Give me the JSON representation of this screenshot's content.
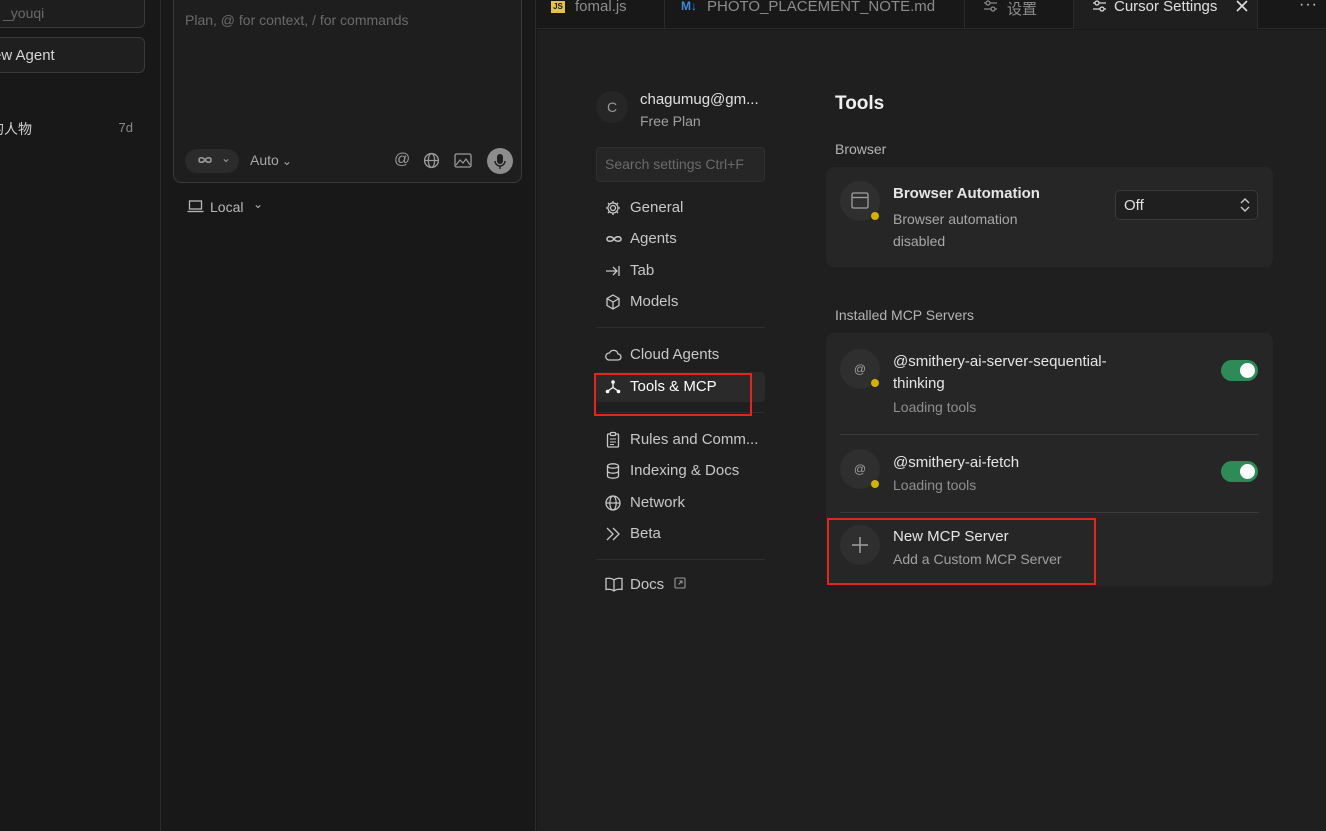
{
  "left_sidebar": {
    "search_text": "_youqi",
    "new_agent_label": "ew Agent",
    "history": [
      {
        "title": "的人物",
        "age": "7d"
      }
    ]
  },
  "composer": {
    "placeholder": "Plan, @ for context, / for commands",
    "mode_icon": "infinity-icon",
    "model_label": "Auto",
    "location_label": "Local"
  },
  "tabs": [
    {
      "label": "fomal.js",
      "icon": "js-file-icon"
    },
    {
      "label": "PHOTO_PLACEMENT_NOTE.md",
      "icon": "markdown-icon"
    },
    {
      "label": "设置",
      "icon": "settings-sliders-icon"
    },
    {
      "label": "Cursor Settings",
      "icon": "settings-sliders-icon",
      "active": true
    }
  ],
  "settings": {
    "user": {
      "initial": "C",
      "email": "chagumug@gm...",
      "plan": "Free Plan"
    },
    "search_placeholder": "Search settings Ctrl+F",
    "nav": [
      {
        "label": "General",
        "icon": "gear-icon"
      },
      {
        "label": "Agents",
        "icon": "infinity-icon"
      },
      {
        "label": "Tab",
        "icon": "tab-arrow-icon"
      },
      {
        "label": "Models",
        "icon": "cube-icon"
      },
      {
        "label": "Cloud Agents",
        "icon": "cloud-icon"
      },
      {
        "label": "Tools & MCP",
        "icon": "network-nodes-icon",
        "selected": true
      },
      {
        "label": "Rules and Comm...",
        "icon": "clipboard-icon"
      },
      {
        "label": "Indexing & Docs",
        "icon": "database-icon"
      },
      {
        "label": "Network",
        "icon": "globe-icon"
      },
      {
        "label": "Beta",
        "icon": "double-chevron-icon"
      },
      {
        "label": "Docs",
        "icon": "book-icon"
      }
    ],
    "title": "Tools",
    "browser_section": "Browser",
    "browser_automation": {
      "title": "Browser Automation",
      "subtitle_line1": "Browser automation",
      "subtitle_line2": "disabled",
      "value": "Off"
    },
    "mcp_section": "Installed MCP Servers",
    "mcp_servers": [
      {
        "name_line1": "@smithery-ai-server-sequential-",
        "name_line2": "thinking",
        "status": "Loading tools",
        "enabled": true
      },
      {
        "name_line1": "@smithery-ai-fetch",
        "status": "Loading tools",
        "enabled": true
      }
    ],
    "new_server": {
      "title": "New MCP Server",
      "subtitle": "Add a Custom MCP Server"
    }
  },
  "colors": {
    "highlight": "#e2251f",
    "toggle_on": "#2e8b57",
    "status_warning": "#d4b106"
  }
}
